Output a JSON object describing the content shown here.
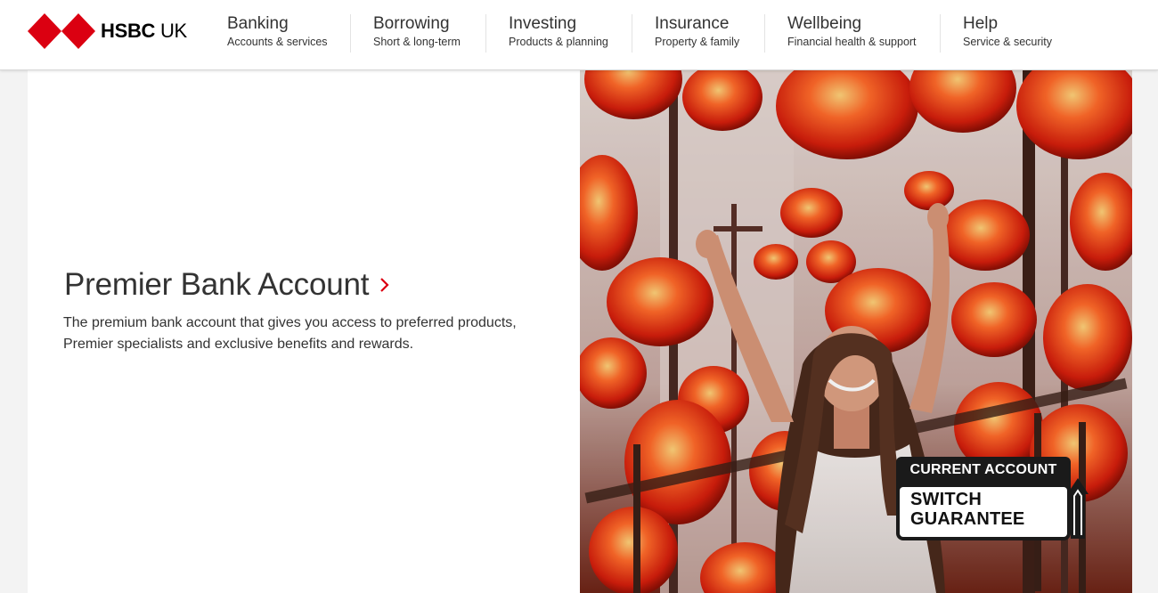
{
  "brand": {
    "name_bold": "HSBC",
    "name_light": "UK",
    "primary_color": "#db0011"
  },
  "nav": [
    {
      "title": "Banking",
      "subtitle": "Accounts & services"
    },
    {
      "title": "Borrowing",
      "subtitle": "Short & long-term"
    },
    {
      "title": "Investing",
      "subtitle": "Products & planning"
    },
    {
      "title": "Insurance",
      "subtitle": "Property & family"
    },
    {
      "title": "Wellbeing",
      "subtitle": "Financial health & support"
    },
    {
      "title": "Help",
      "subtitle": "Service & security"
    }
  ],
  "hero": {
    "title": "Premier Bank Account",
    "description": "The premium bank account that gives you access to preferred products, Premier specialists and exclusive benefits and rewards.",
    "chevron_icon": "chevron-right-icon"
  },
  "badge": {
    "top_text": "CURRENT ACCOUNT",
    "line1": "SWITCH",
    "line2": "GUARANTEE"
  }
}
